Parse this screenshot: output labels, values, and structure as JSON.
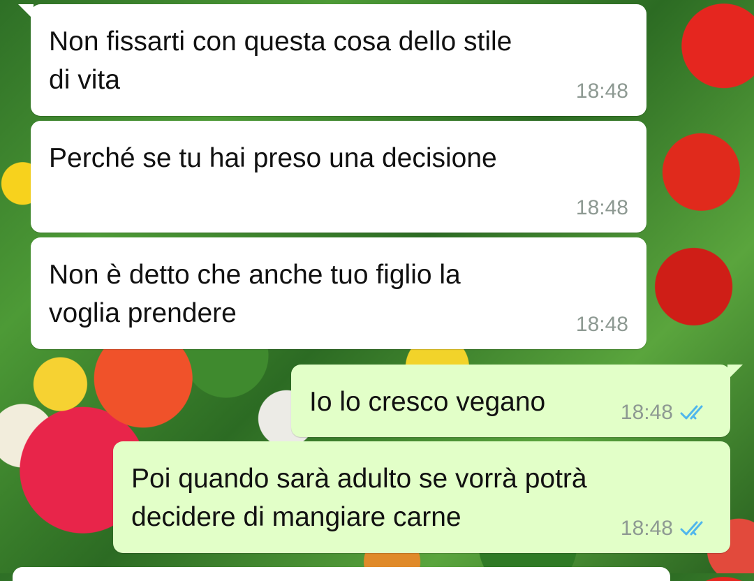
{
  "chat": {
    "messages": [
      {
        "direction": "incoming",
        "text": "Non fissarti con questa cosa dello stile\ndi vita",
        "time": "18:48"
      },
      {
        "direction": "incoming",
        "text": "Perché se tu hai preso una decisione",
        "time": "18:48"
      },
      {
        "direction": "incoming",
        "text": "Non è detto che anche tuo figlio la\nvoglia prendere",
        "time": "18:48"
      },
      {
        "direction": "outgoing",
        "text": "Io lo cresco vegano",
        "time": "18:48",
        "status_icon": "double-check-icon"
      },
      {
        "direction": "outgoing",
        "text": "Poi quando sarà adulto se vorrà potrà\ndecidere di mangiare carne",
        "time": "18:48",
        "status_icon": "double-check-icon"
      }
    ]
  },
  "colors": {
    "incoming_bubble": "#ffffff",
    "outgoing_bubble": "#e2ffc8",
    "timestamp": "#8d9992",
    "read_ticks": "#4fb6ec"
  }
}
